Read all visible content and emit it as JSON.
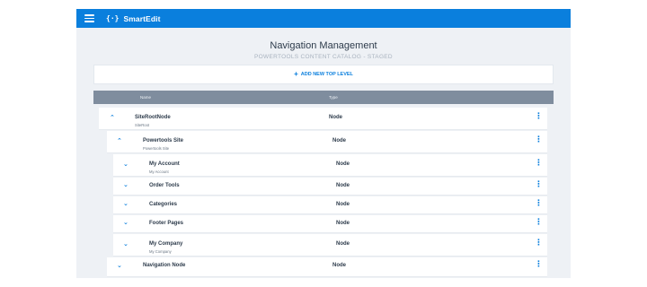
{
  "topbar": {
    "menu_icon": "hamburger-icon",
    "logo_mark": "{·}",
    "app_title": "SmartEdit",
    "color": "#0a7fdd"
  },
  "page": {
    "title": "Navigation Management",
    "subtitle": "POWERTOOLS CONTENT CATALOG - STAGED",
    "add_button_icon": "+",
    "add_button_label": "ADD NEW TOP LEVEL"
  },
  "table": {
    "columns": {
      "name": "Name",
      "type": "Type"
    },
    "rows": [
      {
        "chevron": "⌃",
        "name": "SiteRootNode",
        "sub": "SiteRoot",
        "type": "Node",
        "more": "⋮"
      },
      {
        "chevron": "⌃",
        "name": "Powertools Site",
        "sub": "Powertools Site",
        "type": "Node",
        "more": "⋮"
      },
      {
        "chevron": "⌄",
        "name": "My Account",
        "sub": "My Account",
        "type": "Node",
        "more": "⋮"
      },
      {
        "chevron": "⌄",
        "name": "Order Tools",
        "sub": "",
        "type": "Node",
        "more": "⋮"
      },
      {
        "chevron": "⌄",
        "name": "Categories",
        "sub": "",
        "type": "Node",
        "more": "⋮"
      },
      {
        "chevron": "⌄",
        "name": "Footer Pages",
        "sub": "",
        "type": "Node",
        "more": "⋮"
      },
      {
        "chevron": "⌄",
        "name": "My Company",
        "sub": "My Company",
        "type": "Node",
        "more": "⋮"
      },
      {
        "chevron": "⌄",
        "name": "Navigation Node",
        "sub": "",
        "type": "Node",
        "more": "⋮"
      }
    ]
  }
}
